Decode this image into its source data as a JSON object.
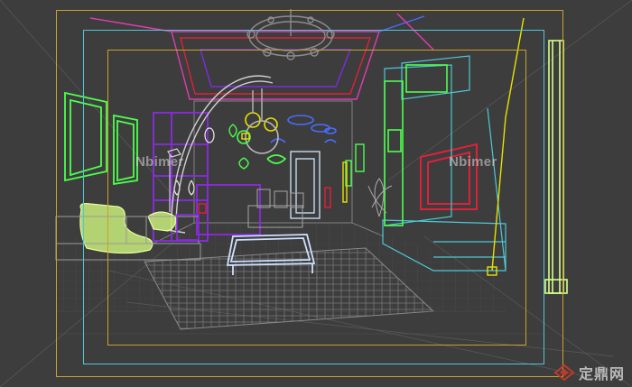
{
  "viewport": {
    "mode": "wireframe",
    "watermark_left": "Nbimer",
    "watermark_right": "Nbimer"
  },
  "logo": {
    "text": "定鼎网"
  },
  "colors": {
    "background": "#3d3d3d",
    "mesh_grey": "#8a8a8a",
    "magenta": "#e23bb0",
    "purple": "#8a2be2",
    "green": "#4dff4d",
    "cyan": "#4fc8d6",
    "blue": "#4a6cff",
    "yellow": "#e8e200",
    "red": "#e0203a",
    "lime": "#d8ff8a",
    "frame_gold": "#c9a227"
  }
}
